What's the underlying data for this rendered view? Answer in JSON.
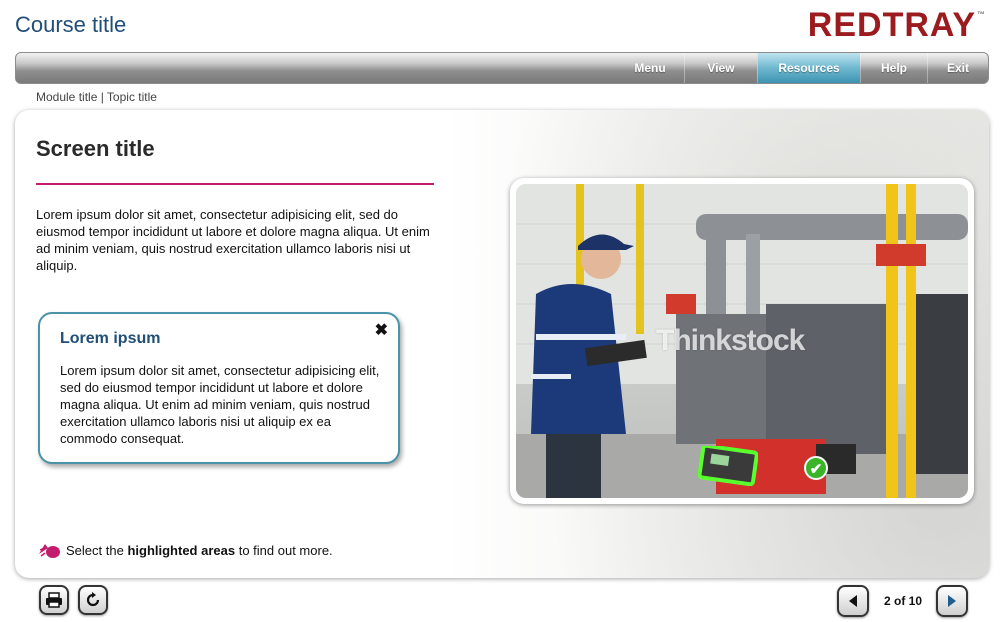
{
  "header": {
    "course_title": "Course title",
    "brand": "REDTRAY",
    "brand_tm": "™"
  },
  "nav": {
    "items": [
      {
        "label": "Menu",
        "active": false
      },
      {
        "label": "View",
        "active": false
      },
      {
        "label": "Resources",
        "active": true
      },
      {
        "label": "Help",
        "active": false
      },
      {
        "label": "Exit",
        "active": false
      }
    ],
    "active_color": "#4aa3c0"
  },
  "breadcrumb": "Module title | Topic title",
  "screen": {
    "title": "Screen title",
    "intro": "Lorem ipsum dolor sit amet, consectetur adipisicing elit, sed do eiusmod tempor incididunt ut labore et dolore magna aliqua. Ut enim ad minim veniam, quis nostrud exercitation ullamco laboris nisi ut aliquip.",
    "accent_color": "#c21c6c"
  },
  "popup": {
    "title": "Lorem ipsum",
    "close": "✖",
    "body": "Lorem ipsum dolor sit amet, consectetur adipisicing elit, sed do eiusmod tempor incididunt ut labore et dolore magna aliqua. Ut enim ad minim veniam, quis nostrud exercitation ullamco laboris nisi ut aliquip ex ea commodo consequat.",
    "border_color": "#4a93a8"
  },
  "photo": {
    "watermark": "Thinkstock",
    "hotspot_status": "✔"
  },
  "instruction": {
    "prefix": "Select the ",
    "bold": "highlighted areas",
    "suffix": " to find out more."
  },
  "footer": {
    "print_icon": "printer-icon",
    "replay_icon": "replay-icon",
    "prev_icon": "arrow-left-icon",
    "next_icon": "arrow-right-icon",
    "page_counter": "2 of 10"
  }
}
